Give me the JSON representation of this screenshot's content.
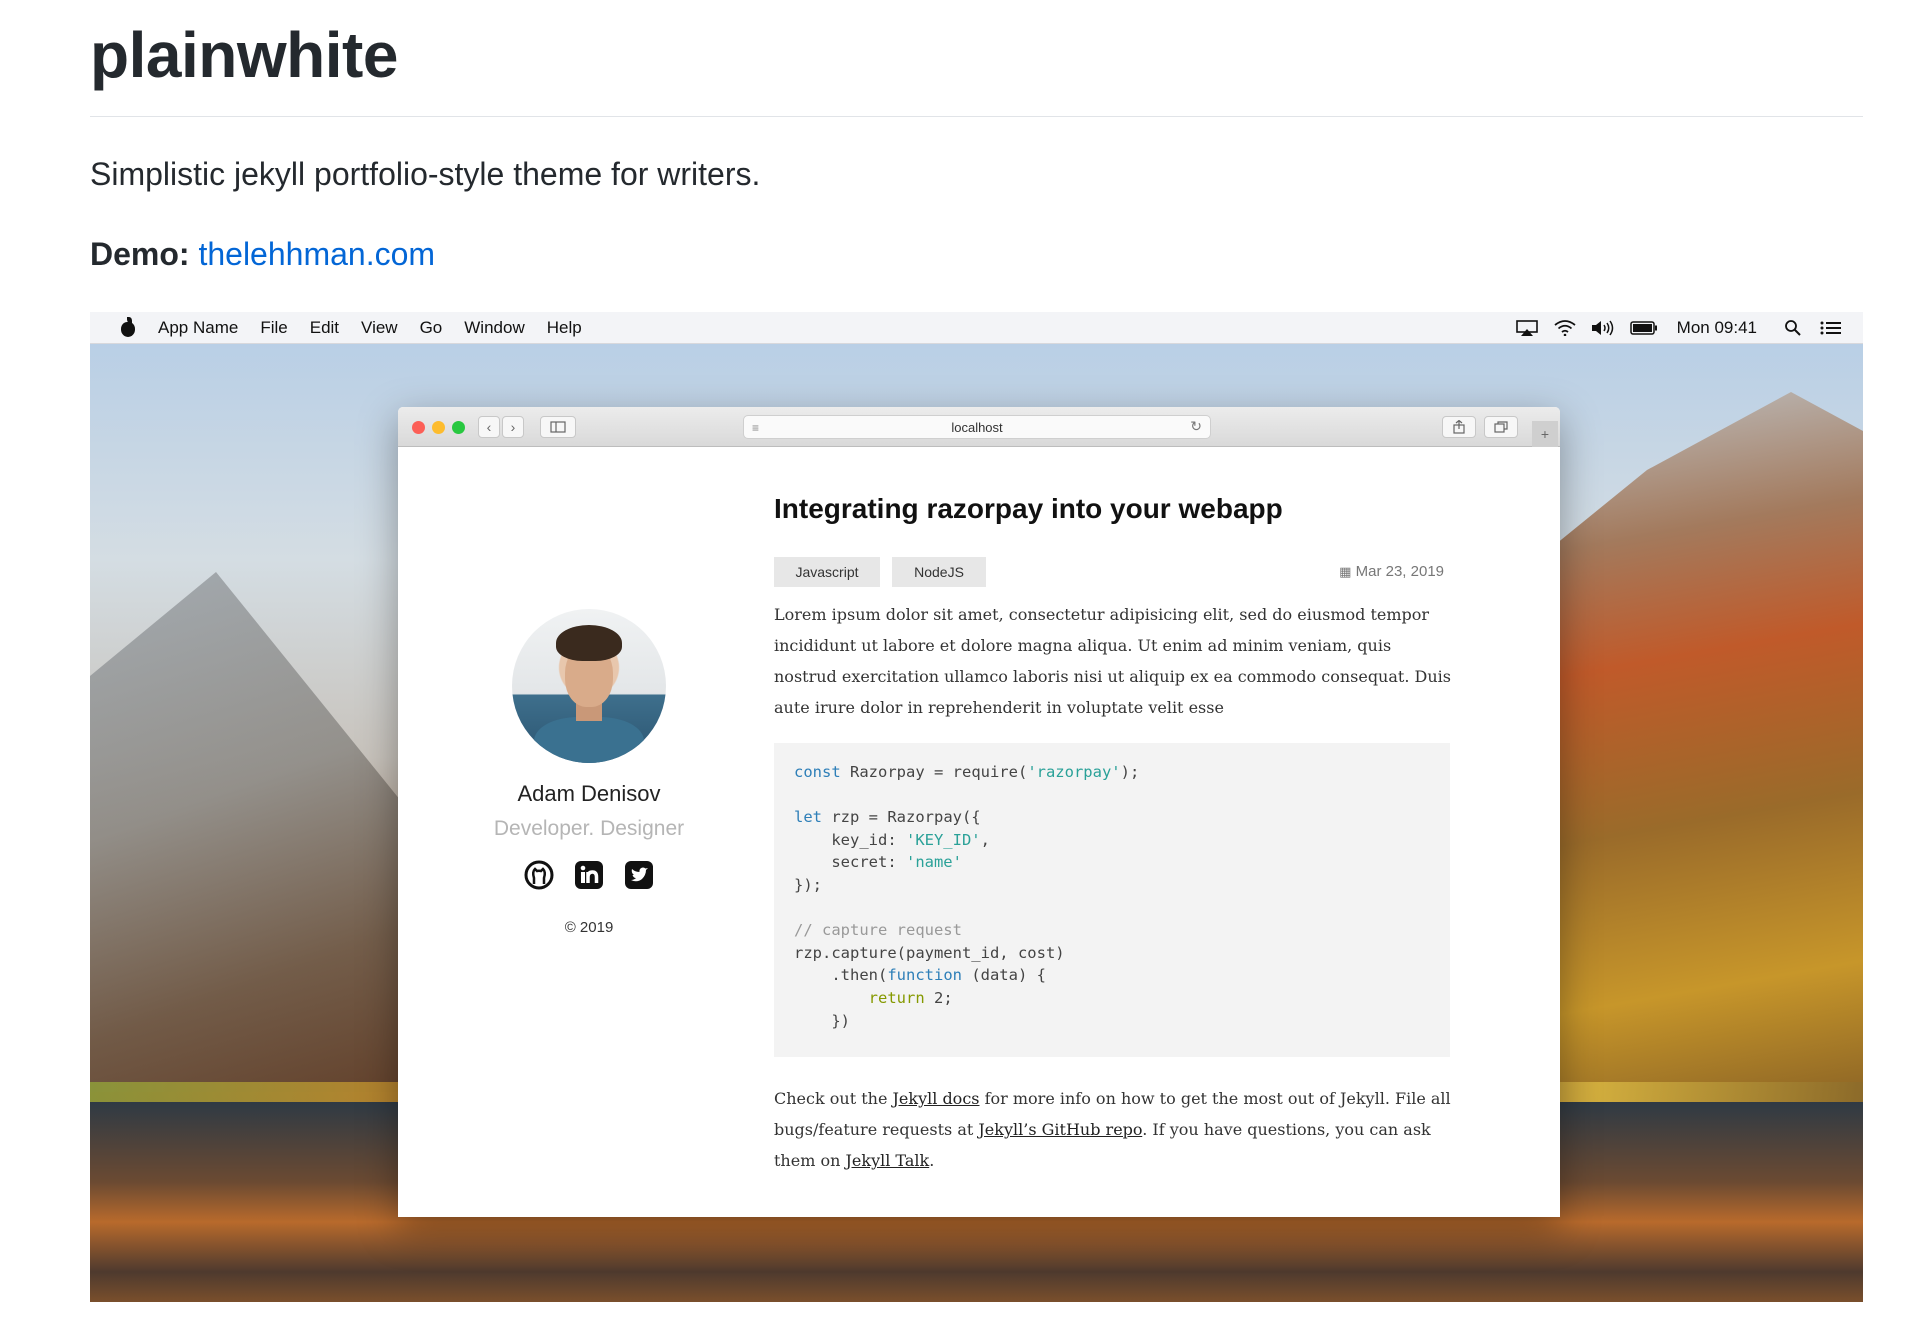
{
  "readme": {
    "title": "plainwhite",
    "description": "Simplistic jekyll portfolio-style theme for writers.",
    "demo_label": "Demo:",
    "demo_link": "thelehhman.com"
  },
  "menubar": {
    "app_name": "App Name",
    "items": [
      "File",
      "Edit",
      "View",
      "Go",
      "Window",
      "Help"
    ],
    "clock": "Mon 09:41"
  },
  "browser": {
    "url": "localhost"
  },
  "profile": {
    "name": "Adam Denisov",
    "role": "Developer. Designer",
    "copyright": "© 2019"
  },
  "post": {
    "title": "Integrating razorpay into your webapp",
    "tags": [
      "Javascript",
      "NodeJS"
    ],
    "date": "Mar 23, 2019",
    "intro": "Lorem ipsum dolor sit amet, consectetur adipisicing elit, sed do eiusmod tempor incididunt ut labore et dolore magna aliqua. Ut enim ad minim veniam, quis nostrud exercitation ullamco laboris nisi ut aliquip ex ea commodo consequat. Duis aute irure dolor in reprehenderit in voluptate velit esse",
    "outro": {
      "t1": "Check out the ",
      "l1": "Jekyll docs",
      "t2": " for more info on how to get the most out of Jekyll. File all bugs/feature requests at ",
      "l2": "Jekyll’s GitHub repo",
      "t3": ". If you have questions, you can ask them on ",
      "l3": "Jekyll Talk",
      "t4": "."
    },
    "code": {
      "l1a": "const",
      "l1b": " Razorpay = require(",
      "l1c": "'razorpay'",
      "l1d": ");",
      "l3a": "let",
      "l3b": " rzp = Razorpay({",
      "l4a": "    key_id: ",
      "l4b": "'KEY_ID'",
      "l4c": ",",
      "l5a": "    secret: ",
      "l5b": "'name'",
      "l6": "});",
      "l8": "// capture request",
      "l9": "rzp.capture(payment_id, cost)",
      "l10a": "    .then(",
      "l10b": "function",
      "l10c": " (data) {",
      "l11a": "        ",
      "l11b": "return",
      "l11c": " 2;",
      "l12": "    })"
    }
  },
  "colors": {
    "link": "#0366d6",
    "keyword": "#2e7fb8",
    "string": "#2aa198"
  }
}
